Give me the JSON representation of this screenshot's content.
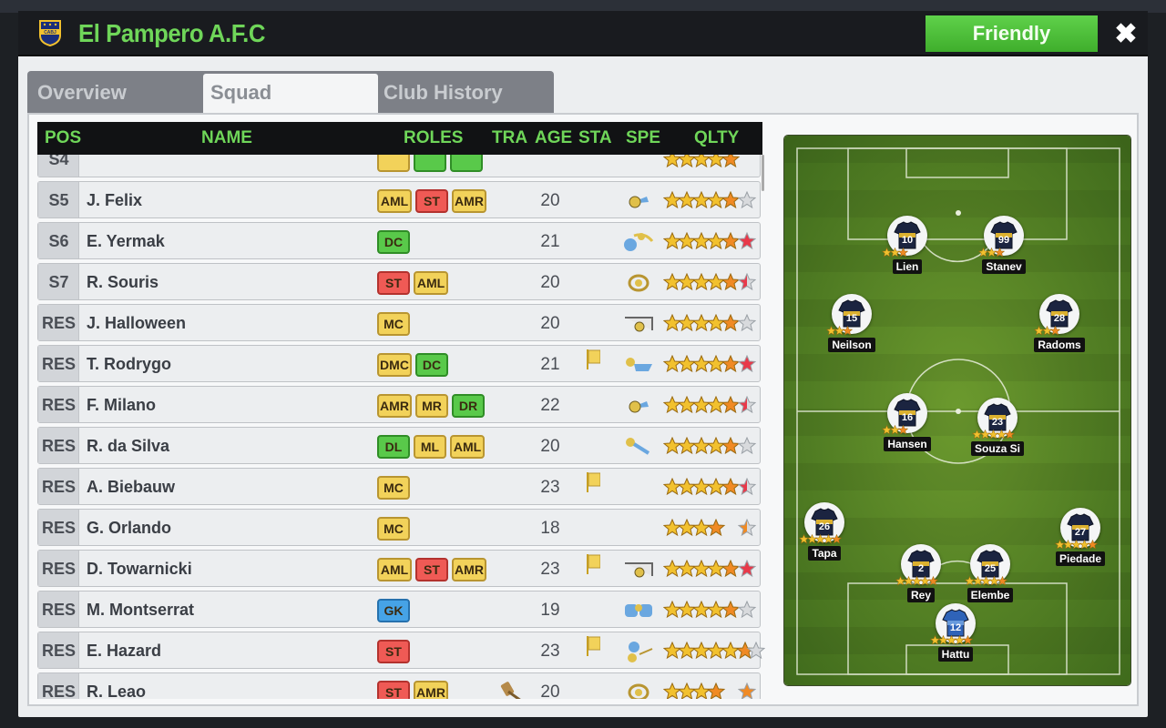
{
  "header": {
    "team_name": "El Pampero A.F.C",
    "crest_text": "CABJ",
    "friendly_label": "Friendly",
    "close_label": "✖"
  },
  "tabs": [
    {
      "label": "Overview",
      "active": false
    },
    {
      "label": "Squad",
      "active": true
    },
    {
      "label": "Club History",
      "active": false
    }
  ],
  "table": {
    "columns": [
      "POS",
      "NAME",
      "ROLES",
      "TRA",
      "AGE",
      "STA",
      "SPE",
      "QLTY"
    ],
    "rows": [
      {
        "pos": "S4",
        "name": "",
        "roles": [
          {
            "t": "",
            "c": "y"
          },
          {
            "t": "",
            "c": "g"
          },
          {
            "t": "",
            "c": "g"
          }
        ],
        "age": "",
        "flag": false,
        "spe": "",
        "stars": 5.5,
        "big": "",
        "partial": true
      },
      {
        "pos": "S5",
        "name": "J. Felix",
        "roles": [
          {
            "t": "AML",
            "c": "y"
          },
          {
            "t": "ST",
            "c": "r"
          },
          {
            "t": "AMR",
            "c": "y"
          }
        ],
        "age": "20",
        "flag": false,
        "spe": "ball",
        "stars": 5.5,
        "big": "grey"
      },
      {
        "pos": "S6",
        "name": "E. Yermak",
        "roles": [
          {
            "t": "DC",
            "c": "g"
          }
        ],
        "age": "21",
        "flag": false,
        "spe": "header",
        "stars": 5.5,
        "big": "red"
      },
      {
        "pos": "S7",
        "name": "R. Souris",
        "roles": [
          {
            "t": "ST",
            "c": "r"
          },
          {
            "t": "AML",
            "c": "y"
          }
        ],
        "age": "20",
        "flag": false,
        "spe": "target",
        "stars": 5.5,
        "big": "half-red"
      },
      {
        "pos": "RES",
        "name": "J. Halloween",
        "roles": [
          {
            "t": "MC",
            "c": "y"
          }
        ],
        "age": "20",
        "flag": false,
        "spe": "goal",
        "stars": 5.5,
        "big": "grey"
      },
      {
        "pos": "RES",
        "name": "T. Rodrygo",
        "roles": [
          {
            "t": "DMC",
            "c": "y"
          },
          {
            "t": "DC",
            "c": "g"
          }
        ],
        "age": "21",
        "flag": true,
        "spe": "tackle",
        "stars": 5.5,
        "big": "red"
      },
      {
        "pos": "RES",
        "name": "F. Milano",
        "roles": [
          {
            "t": "AMR",
            "c": "y"
          },
          {
            "t": "MR",
            "c": "y"
          },
          {
            "t": "DR",
            "c": "g"
          }
        ],
        "age": "22",
        "flag": false,
        "spe": "ball",
        "stars": 5.5,
        "big": "half-red"
      },
      {
        "pos": "RES",
        "name": "R. da Silva",
        "roles": [
          {
            "t": "DL",
            "c": "g"
          },
          {
            "t": "ML",
            "c": "y"
          },
          {
            "t": "AML",
            "c": "y"
          }
        ],
        "age": "20",
        "flag": false,
        "spe": "kick",
        "stars": 5.5,
        "big": "grey"
      },
      {
        "pos": "RES",
        "name": "A. Biebauw",
        "roles": [
          {
            "t": "MC",
            "c": "y"
          }
        ],
        "age": "23",
        "flag": true,
        "spe": "",
        "stars": 5.5,
        "big": "half-red"
      },
      {
        "pos": "RES",
        "name": "G. Orlando",
        "roles": [
          {
            "t": "MC",
            "c": "y"
          }
        ],
        "age": "18",
        "flag": false,
        "spe": "",
        "stars": 4.5,
        "big": "half-orange"
      },
      {
        "pos": "RES",
        "name": "D. Towarnicki",
        "roles": [
          {
            "t": "AML",
            "c": "y"
          },
          {
            "t": "ST",
            "c": "r"
          },
          {
            "t": "AMR",
            "c": "y"
          }
        ],
        "age": "23",
        "flag": true,
        "spe": "goal",
        "stars": 5.5,
        "big": "red"
      },
      {
        "pos": "RES",
        "name": "M. Montserrat",
        "roles": [
          {
            "t": "GK",
            "c": "b"
          }
        ],
        "age": "19",
        "flag": false,
        "spe": "gloves",
        "stars": 5.5,
        "big": "grey"
      },
      {
        "pos": "RES",
        "name": "E. Hazard",
        "roles": [
          {
            "t": "ST",
            "c": "r"
          }
        ],
        "age": "23",
        "flag": true,
        "spe": "dribble",
        "stars": 6.5,
        "big": "grey"
      },
      {
        "pos": "RES",
        "name": "R. Leao",
        "roles": [
          {
            "t": "ST",
            "c": "r"
          },
          {
            "t": "AMR",
            "c": "y"
          }
        ],
        "age": "20",
        "flag": false,
        "spe": "target",
        "stars": 4.5,
        "big": "orange",
        "transfer": true
      }
    ]
  },
  "formation": [
    {
      "name": "Lien",
      "number": "10",
      "stars": 3,
      "kit": "home"
    },
    {
      "name": "Stanev",
      "number": "99",
      "stars": 3,
      "kit": "home"
    },
    {
      "name": "Neilson",
      "number": "15",
      "stars": 3,
      "kit": "home"
    },
    {
      "name": "Radoms",
      "number": "28",
      "stars": 3,
      "kit": "home"
    },
    {
      "name": "Hansen",
      "number": "16",
      "stars": 3,
      "kit": "home"
    },
    {
      "name": "Souza Si",
      "number": "23",
      "stars": 5,
      "kit": "home"
    },
    {
      "name": "Tapa",
      "number": "26",
      "stars": 5,
      "kit": "home"
    },
    {
      "name": "Piedade",
      "number": "27",
      "stars": 5,
      "kit": "home"
    },
    {
      "name": "Rey",
      "number": "2",
      "stars": 5,
      "kit": "home"
    },
    {
      "name": "Elembe",
      "number": "25",
      "stars": 5,
      "kit": "home"
    },
    {
      "name": "Hattu",
      "number": "12",
      "stars": 5,
      "kit": "gk"
    }
  ],
  "colors": {
    "accent_green": "#6fd659",
    "button_green": "#4cc23a",
    "star_gold": "#f2c12e",
    "star_orange": "#f08a24",
    "star_red": "#e8394a"
  }
}
